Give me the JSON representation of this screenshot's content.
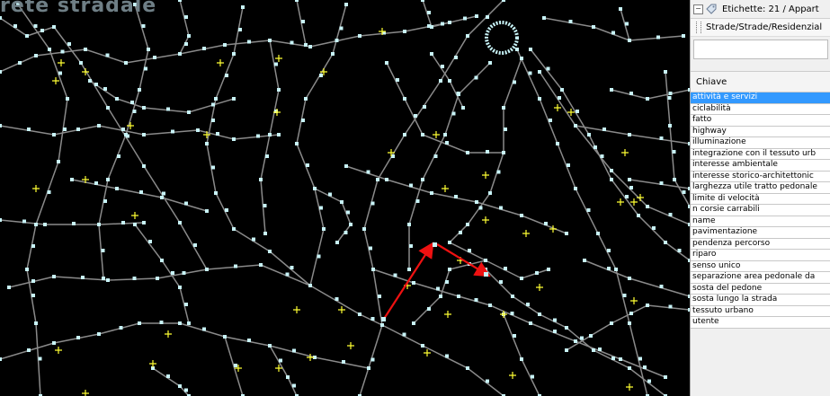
{
  "map": {
    "overlay_text": "rete stradale",
    "colors": {
      "background": "#000000",
      "road": "#8a8a8a",
      "node": "#c8f4f8",
      "label_marker": "#ffff33",
      "route": "#ee1111"
    }
  },
  "panel": {
    "header_label": "Etichette: 21 / Appart",
    "path_label": "Strade/Strade/Residenzial",
    "column_header": "Chiave",
    "keys": [
      "attività e servizi",
      "ciclabilità",
      "fatto",
      "highway",
      "illuminazione",
      "integrazione con il tessuto urb",
      "interesse ambientale",
      "interesse storico-architettonic",
      "larghezza utile tratto pedonale",
      "limite di velocità",
      "n corsie carrabili",
      "name",
      "pavimentazione",
      "pendenza percorso",
      "riparo",
      "senso unico",
      "separazione area pedonale da",
      "sosta del pedone",
      "sosta lungo la strada",
      "tessuto urbano",
      "utente"
    ],
    "selected_key": "attività e servizi"
  }
}
